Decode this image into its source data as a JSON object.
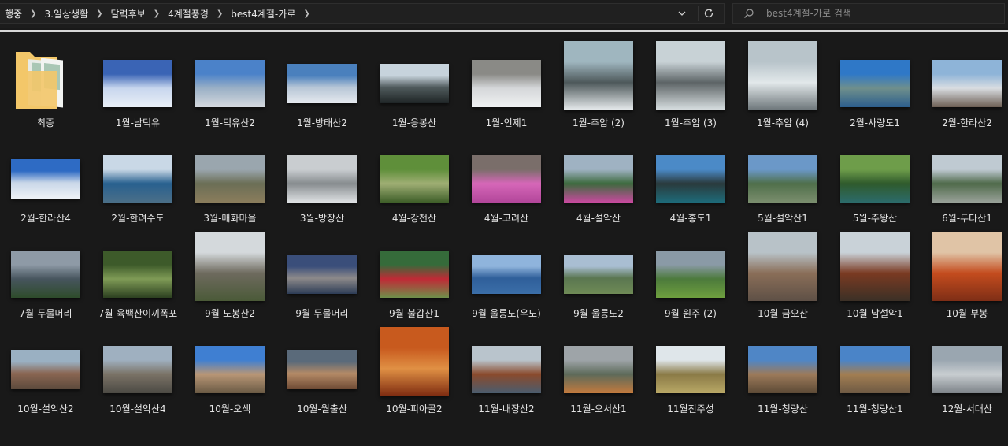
{
  "address": {
    "crumbs": [
      "행중",
      "3.일상생활",
      "달력후보",
      "4계절풍경",
      "best4계절-가로"
    ]
  },
  "search": {
    "placeholder": "best4계절-가로 검색"
  },
  "items": [
    {
      "label": "최종",
      "kind": "folder",
      "colors": [
        "#f3c769",
        "#a9c7b5"
      ]
    },
    {
      "label": "1월-남덕유",
      "kind": "image",
      "colors": [
        "#3a64b5",
        "#c8d6ee",
        "#e8eef6"
      ]
    },
    {
      "label": "1월-덕유산2",
      "kind": "image",
      "colors": [
        "#4b82c9",
        "#9ab0c6",
        "#d4d8dd"
      ]
    },
    {
      "label": "1월-방태산2",
      "kind": "image",
      "colors": [
        "#4a80bd",
        "#b7c6d6",
        "#e5e9ee"
      ],
      "shape": "wide"
    },
    {
      "label": "1월-응봉산",
      "kind": "image",
      "colors": [
        "#c7d3dc",
        "#4f5a5c",
        "#1f2526"
      ],
      "shape": "wide"
    },
    {
      "label": "1월-인제1",
      "kind": "image",
      "colors": [
        "#8a8a86",
        "#d5d7d9",
        "#eff1f2"
      ]
    },
    {
      "label": "1월-추암 (2)",
      "kind": "image",
      "colors": [
        "#9fb6bf",
        "#4d585a",
        "#e8ecee"
      ],
      "shape": "tall"
    },
    {
      "label": "1월-추암 (3)",
      "kind": "image",
      "colors": [
        "#c8d2d6",
        "#5d6466",
        "#d9e0e2"
      ],
      "shape": "tall"
    },
    {
      "label": "1월-추암 (4)",
      "kind": "image",
      "colors": [
        "#b8c4ca",
        "#e2e8ea",
        "#6c7579"
      ],
      "shape": "tall"
    },
    {
      "label": "2월-사량도1",
      "kind": "image",
      "colors": [
        "#2f78c7",
        "#6f8f8c",
        "#2c5e8d"
      ]
    },
    {
      "label": "2월-한라산2",
      "kind": "image",
      "colors": [
        "#8eb4d8",
        "#d9dde1",
        "#6d5f54"
      ]
    },
    {
      "label": "2월-한라산4",
      "kind": "image",
      "colors": [
        "#2e6bc4",
        "#c9d7e8",
        "#eef2f7"
      ],
      "shape": "wide"
    },
    {
      "label": "2월-한려수도",
      "kind": "image",
      "colors": [
        "#c9d8e6",
        "#28608f",
        "#4b6f88"
      ]
    },
    {
      "label": "3월-매화마을",
      "kind": "image",
      "colors": [
        "#9aa6ae",
        "#6b6e56",
        "#8b7d5c"
      ]
    },
    {
      "label": "3월-방장산",
      "kind": "image",
      "colors": [
        "#c9cdd0",
        "#878c8f",
        "#dfe2e4"
      ]
    },
    {
      "label": "4월-강천산",
      "kind": "image",
      "colors": [
        "#5f8f3a",
        "#9fae74",
        "#3e5e28"
      ]
    },
    {
      "label": "4월-고려산",
      "kind": "image",
      "colors": [
        "#7a6e6a",
        "#d667b8",
        "#b2469a"
      ]
    },
    {
      "label": "4월-설악산",
      "kind": "image",
      "colors": [
        "#9fb2c2",
        "#3d6a3e",
        "#c94a9f"
      ]
    },
    {
      "label": "4월-홍도1",
      "kind": "image",
      "colors": [
        "#4b8ac7",
        "#2a3a3c",
        "#1e6b7a"
      ]
    },
    {
      "label": "5월-설악산1",
      "kind": "image",
      "colors": [
        "#6b98c8",
        "#4f6f4a",
        "#7b8e6e"
      ]
    },
    {
      "label": "5월-주왕산",
      "kind": "image",
      "colors": [
        "#6e9d4a",
        "#2f5a2c",
        "#2c6b6b"
      ]
    },
    {
      "label": "6월-두타산1",
      "kind": "image",
      "colors": [
        "#bfcad2",
        "#4f6a4a",
        "#9aa29a"
      ]
    },
    {
      "label": "7월-두물머리",
      "kind": "image",
      "colors": [
        "#8e9aa6",
        "#47555e",
        "#2e4c2b"
      ]
    },
    {
      "label": "7월-육백산이끼폭포",
      "kind": "image",
      "colors": [
        "#3d5a2a",
        "#7f9b56",
        "#2c4020"
      ]
    },
    {
      "label": "9월-도봉산2",
      "kind": "image",
      "colors": [
        "#d4d9dc",
        "#6e6a5e",
        "#4b5a38"
      ],
      "shape": "tall"
    },
    {
      "label": "9월-두물머리",
      "kind": "image",
      "colors": [
        "#3a4e7a",
        "#8d8a8a",
        "#2d3c56"
      ],
      "shape": "wide"
    },
    {
      "label": "9월-불갑산1",
      "kind": "image",
      "colors": [
        "#356b3a",
        "#c02a36",
        "#6e8f4a"
      ]
    },
    {
      "label": "9월-울릉도(우도)",
      "kind": "image",
      "colors": [
        "#8fb4dc",
        "#2f5f9a",
        "#3b6ea8"
      ],
      "shape": "wide"
    },
    {
      "label": "9월-울릉도2",
      "kind": "image",
      "colors": [
        "#a9bed2",
        "#5a7650",
        "#6f8a56"
      ],
      "shape": "wide"
    },
    {
      "label": "9월-원주 (2)",
      "kind": "image",
      "colors": [
        "#8a9aa6",
        "#4c7a3c",
        "#6e9f3e"
      ]
    },
    {
      "label": "10월-금오산",
      "kind": "image",
      "colors": [
        "#b8c2c8",
        "#8a6e58",
        "#5e5046"
      ],
      "shape": "tall"
    },
    {
      "label": "10월-남설악1",
      "kind": "image",
      "colors": [
        "#c9d2d8",
        "#7a3a22",
        "#3b3026"
      ],
      "shape": "tall"
    },
    {
      "label": "10월-부봉",
      "kind": "image",
      "colors": [
        "#e0c4a6",
        "#c44c1e",
        "#7e2e16"
      ],
      "shape": "tall"
    },
    {
      "label": "10월-설악산2",
      "kind": "image",
      "colors": [
        "#9ab0c2",
        "#8a6652",
        "#5c4a3c"
      ],
      "shape": "wide"
    },
    {
      "label": "10월-설악산4",
      "kind": "image",
      "colors": [
        "#9fb0c0",
        "#7a7266",
        "#4c4a44"
      ]
    },
    {
      "label": "10월-오색",
      "kind": "image",
      "colors": [
        "#3f7fd2",
        "#b89676",
        "#6a5a44"
      ]
    },
    {
      "label": "10월-월출산",
      "kind": "image",
      "colors": [
        "#5a6a7a",
        "#b48a66",
        "#6e4a34"
      ],
      "shape": "wide"
    },
    {
      "label": "10월-피아골2",
      "kind": "image",
      "colors": [
        "#c85a1e",
        "#e09044",
        "#7c2a10"
      ],
      "shape": "tall"
    },
    {
      "label": "11월-내장산2",
      "kind": "image",
      "colors": [
        "#b9c4cc",
        "#8a4a2c",
        "#4a5c6e"
      ]
    },
    {
      "label": "11월-오서산1",
      "kind": "image",
      "colors": [
        "#9ea4a8",
        "#5d6a5a",
        "#c27a3e"
      ]
    },
    {
      "label": "11월진주성",
      "kind": "image",
      "colors": [
        "#dfe6ea",
        "#8a7a46",
        "#b9a866"
      ]
    },
    {
      "label": "11월-청량산",
      "kind": "image",
      "colors": [
        "#4f86c6",
        "#9c7a5a",
        "#5c4a36"
      ]
    },
    {
      "label": "11월-청량산1",
      "kind": "image",
      "colors": [
        "#4a84c8",
        "#a27e52",
        "#6e5a44"
      ]
    },
    {
      "label": "12월-서대산",
      "kind": "image",
      "colors": [
        "#9aa6b0",
        "#c8cdd0",
        "#7d8388"
      ]
    }
  ]
}
